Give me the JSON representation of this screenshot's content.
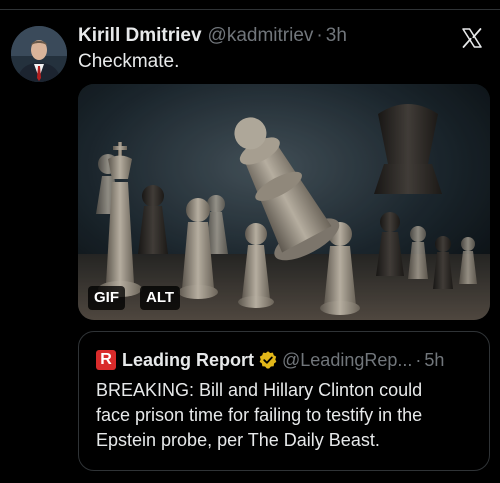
{
  "post": {
    "author_name": "Kirill Dmitriev",
    "handle": "@kadmitriev",
    "separator": "·",
    "time": "3h",
    "text": "Checkmate.",
    "avatar_icon": "person-avatar",
    "close_icon": "x-logo-icon"
  },
  "media": {
    "type": "gif",
    "gif_badge": "GIF",
    "alt_badge": "ALT"
  },
  "quote": {
    "logo_letter": "R",
    "name": "Leading Report",
    "verified_icon": "gold-verified-badge",
    "handle": "@LeadingRep...",
    "separator": "·",
    "time": "5h",
    "text_lines": [
      "BREAKING: Bill and Hillary Clinton could",
      "face prison time for failing to testify in the",
      "Epstein probe, per The Daily Beast."
    ]
  },
  "colors": {
    "background": "#000000",
    "text": "#e7e9ea",
    "muted": "#71767b",
    "border": "#2f3336",
    "verified_gold": "#e2b719",
    "logo_red": "#d92b2b"
  }
}
